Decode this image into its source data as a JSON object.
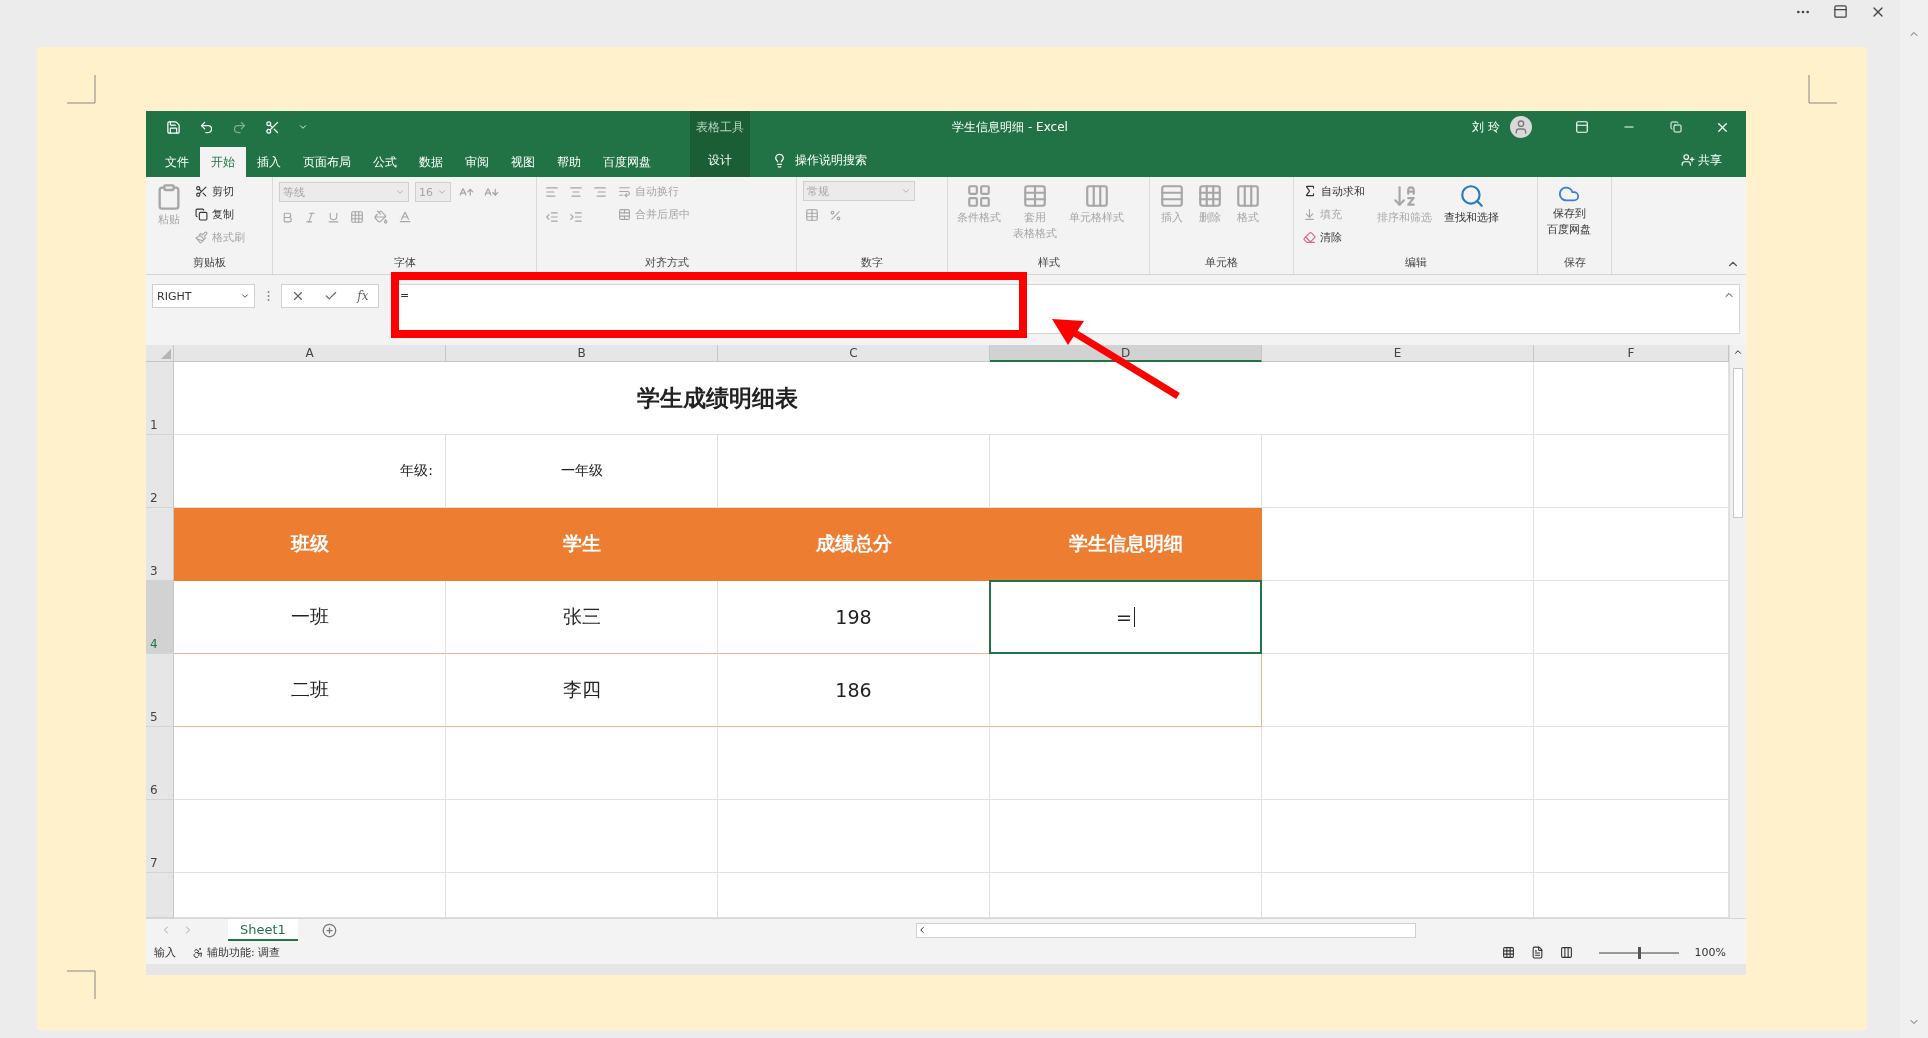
{
  "excel": {
    "context_group": "表格工具",
    "title": "学生信息明细 - Excel",
    "user": "刘 玲",
    "tabs": [
      {
        "label": "文件",
        "selected": false
      },
      {
        "label": "开始",
        "selected": true
      },
      {
        "label": "插入",
        "selected": false
      },
      {
        "label": "页面布局",
        "selected": false
      },
      {
        "label": "公式",
        "selected": false
      },
      {
        "label": "数据",
        "selected": false
      },
      {
        "label": "审阅",
        "selected": false
      },
      {
        "label": "视图",
        "selected": false
      },
      {
        "label": "帮助",
        "selected": false
      },
      {
        "label": "百度网盘",
        "selected": false
      },
      {
        "label": "设计",
        "selected": false,
        "kind": "context"
      }
    ],
    "tell_me": "操作说明搜索",
    "share": "共享",
    "ribbon": {
      "clipboard": {
        "label": "剪贴板",
        "paste": {
          "label": "粘贴",
          "disabled": true
        },
        "cut": {
          "label": "剪切",
          "disabled": false
        },
        "copy": {
          "label": "复制",
          "disabled": false
        },
        "format_painter": {
          "label": "格式刷",
          "disabled": true
        }
      },
      "font": {
        "label": "字体",
        "font_name": "等线",
        "font_size": "16",
        "disabled": true
      },
      "alignment": {
        "label": "对齐方式",
        "wrap_text": {
          "label": "自动换行",
          "disabled": true
        },
        "merge": {
          "label": "合并后居中",
          "disabled": true
        }
      },
      "number": {
        "label": "数字",
        "format": "常规",
        "disabled": true
      },
      "styles": {
        "label": "样式",
        "items": [
          {
            "lines": [
              "条件格式"
            ],
            "disabled": true
          },
          {
            "lines": [
              "套用",
              "表格格式"
            ],
            "disabled": true
          },
          {
            "lines": [
              "单元格样式"
            ],
            "disabled": true
          }
        ]
      },
      "cells": {
        "label": "单元格",
        "items": [
          {
            "lines": [
              "插入"
            ],
            "disabled": true
          },
          {
            "lines": [
              "删除"
            ],
            "disabled": true
          },
          {
            "lines": [
              "格式"
            ],
            "disabled": true
          }
        ]
      },
      "editing": {
        "label": "编辑",
        "autosum": {
          "label": "自动求和",
          "disabled": false
        },
        "fill": {
          "label": "填充",
          "disabled": true
        },
        "clear": {
          "label": "清除",
          "disabled": false
        },
        "sort_filter": {
          "label": "排序和筛选",
          "disabled": true
        },
        "find_select": {
          "label": "查找和选择",
          "disabled": false
        }
      },
      "save": {
        "label": "保存",
        "baidu": {
          "lines": [
            "保存到",
            "百度网盘"
          ],
          "disabled": false
        }
      }
    },
    "formula_bar": {
      "name_box": "RIGHT",
      "function_label": "fx",
      "formula": "="
    },
    "columns": [
      {
        "label": "A",
        "selected": false
      },
      {
        "label": "B",
        "selected": false
      },
      {
        "label": "C",
        "selected": false
      },
      {
        "label": "D",
        "selected": true
      },
      {
        "label": "E",
        "selected": false
      },
      {
        "label": "F",
        "selected": false
      }
    ],
    "rows": [
      {
        "number": "1",
        "selected": false,
        "kind": "title",
        "cells": [
          {
            "text": "学生成绩明细表"
          }
        ]
      },
      {
        "number": "2",
        "selected": false,
        "kind": "plain",
        "cells": [
          {
            "text": "年级:",
            "kind": "label"
          },
          {
            "text": "一年级"
          }
        ]
      },
      {
        "number": "3",
        "selected": false,
        "kind": "header",
        "cells": [
          {
            "text": "班级"
          },
          {
            "text": "学生"
          },
          {
            "text": "成绩总分"
          },
          {
            "text": "学生信息明细"
          }
        ]
      },
      {
        "number": "4",
        "selected": true,
        "kind": "data",
        "cells": [
          {
            "text": "一班"
          },
          {
            "text": "张三"
          },
          {
            "text": "198"
          },
          {
            "text": "=",
            "active": true
          }
        ]
      },
      {
        "number": "5",
        "selected": false,
        "kind": "data",
        "cells": [
          {
            "text": "二班"
          },
          {
            "text": "李四"
          },
          {
            "text": "186"
          }
        ]
      },
      {
        "number": "6",
        "selected": false,
        "kind": "plain",
        "cells": []
      },
      {
        "number": "7",
        "selected": false,
        "kind": "plain",
        "cells": []
      }
    ],
    "sheet_tabs": [
      {
        "label": "Sheet1",
        "selected": true
      }
    ],
    "status_bar": {
      "mode": "输入",
      "accessibility": "辅助功能: 调查",
      "zoom_slider": {
        "level": 0.5
      },
      "zoom": "100%"
    }
  }
}
